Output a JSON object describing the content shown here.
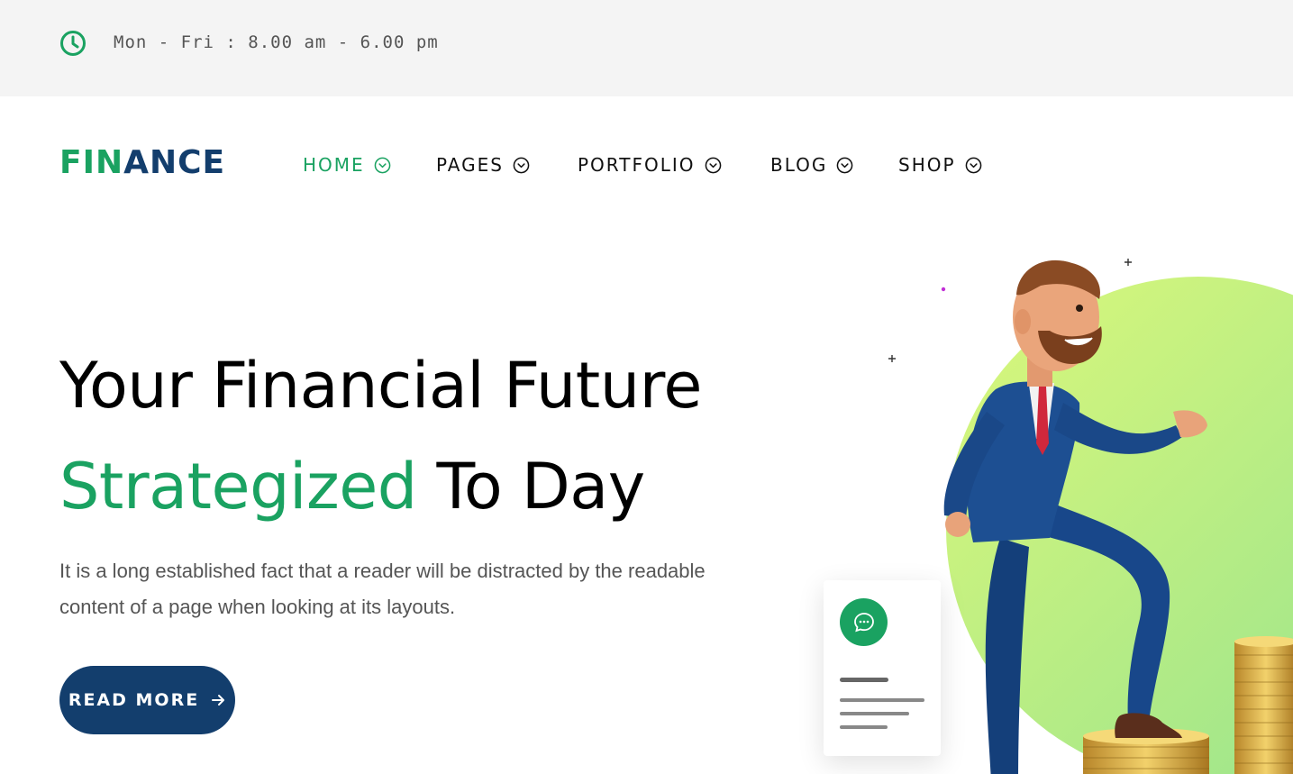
{
  "topbar": {
    "hours": "Mon - Fri : 8.00 am - 6.00 pm",
    "icon": "clock-icon"
  },
  "header": {
    "logo": {
      "part1": "FIN",
      "part2": "ANCE"
    },
    "nav": [
      {
        "label": "HOME",
        "active": true
      },
      {
        "label": "PAGES",
        "active": false
      },
      {
        "label": "PORTFOLIO",
        "active": false
      },
      {
        "label": "BLOG",
        "active": false
      },
      {
        "label": "SHOP",
        "active": false
      }
    ]
  },
  "hero": {
    "title_line1": "Your Financial Future",
    "title_line2_highlight": "Strategized",
    "title_line2_rest": " To Day",
    "description": "It is a long established fact that a reader will be distracted by the readable content of a page when looking at its layouts.",
    "button_label": "READ MORE"
  },
  "colors": {
    "brand_green": "#1aa261",
    "brand_navy": "#133e6d",
    "topbar_bg": "#f4f4f4",
    "blob_light": "#d7f77a",
    "blob_dark": "#9ee58c"
  }
}
